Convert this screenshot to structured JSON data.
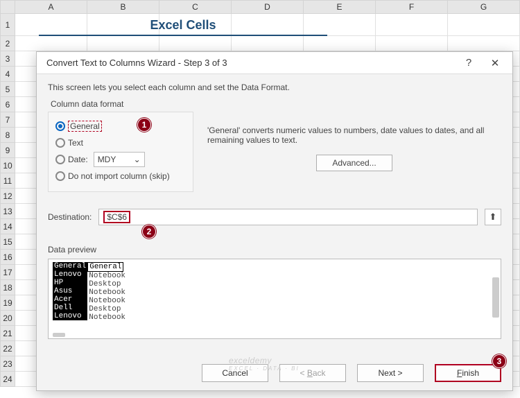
{
  "sheet": {
    "columns": [
      "A",
      "B",
      "C",
      "D",
      "E",
      "F",
      "G"
    ],
    "row_count": 24,
    "title": "Excel Cells"
  },
  "dialog": {
    "title": "Convert Text to Columns Wizard - Step 3 of 3",
    "help_symbol": "?",
    "close_symbol": "✕",
    "description": "This screen lets you select each column and set the Data Format.",
    "format_label": "Column data format",
    "radios": {
      "general": "General",
      "text": "Text",
      "date": "Date:",
      "date_value": "MDY",
      "skip": "Do not import column (skip)"
    },
    "help_text": "'General' converts numeric values to numbers, date values to dates, and all remaining values to text.",
    "advanced": "Advanced...",
    "destination_label": "Destination:",
    "destination_value": "$C$6",
    "collapse_symbol": "⬆",
    "preview_label": "Data preview",
    "preview": {
      "headers": [
        "General",
        "General"
      ],
      "rows": [
        [
          "Lenovo",
          "Notebook"
        ],
        [
          "HP",
          "Desktop"
        ],
        [
          "Asus",
          "Notebook"
        ],
        [
          "Acer",
          "Notebook"
        ],
        [
          "Dell",
          "Desktop"
        ],
        [
          "Lenovo",
          "Notebook"
        ]
      ]
    },
    "buttons": {
      "cancel": "Cancel",
      "back": "< Back",
      "next": "Next >",
      "finish": "Finish"
    }
  },
  "badges": {
    "b1": "1",
    "b2": "2",
    "b3": "3"
  },
  "watermark": {
    "main": "exceldemy",
    "sub": "EXCEL · DATA · BI"
  }
}
